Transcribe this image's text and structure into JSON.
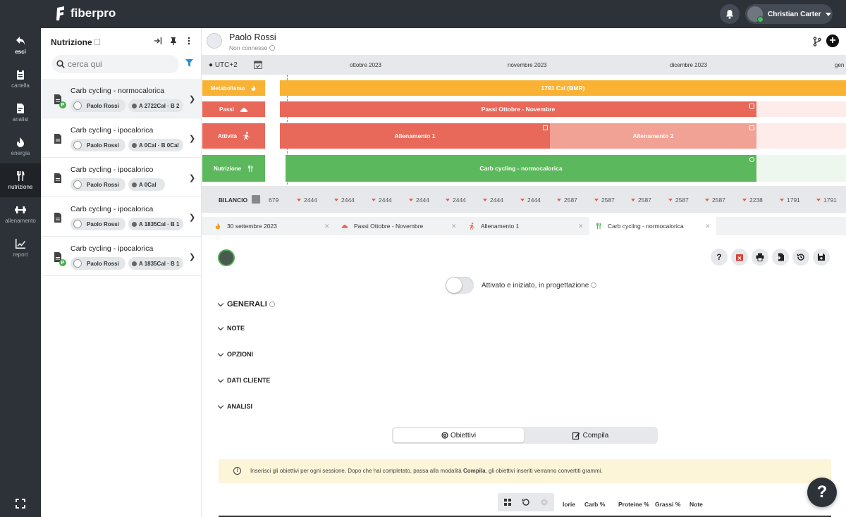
{
  "app": {
    "name": "fiberpro"
  },
  "topbar": {
    "user_name": "Christian Carter"
  },
  "leftnav": {
    "items": [
      {
        "label": "esci",
        "icon": "exit-icon"
      },
      {
        "label": "cartella",
        "icon": "clipboard-icon"
      },
      {
        "label": "analisi",
        "icon": "file-icon"
      },
      {
        "label": "energia",
        "icon": "flame-icon"
      },
      {
        "label": "nutrizione",
        "icon": "fork-knife-icon"
      },
      {
        "label": "allenamento",
        "icon": "dumbbell-icon"
      },
      {
        "label": "report",
        "icon": "chart-icon"
      }
    ]
  },
  "sidebar": {
    "title": "Nutrizione",
    "search_placeholder": "cerca qui",
    "cards": [
      {
        "title": "Carb cycling - normocalorica",
        "person": "Paolo Rossi",
        "cal": "A 2722Cal · B 2",
        "badge": "P"
      },
      {
        "title": "Carb cycling - ipocalorica",
        "person": "Paolo Rossi",
        "cal": "A 0Cal · B 0Cal",
        "badge": ""
      },
      {
        "title": "Carb cycling - ipocalorico",
        "person": "Paolo Rossi",
        "cal": "A 0Cal",
        "badge": ""
      },
      {
        "title": "Carb cycling - ipocalorica",
        "person": "Paolo Rossi",
        "cal": "A 1835Cal · B 1",
        "badge": ""
      },
      {
        "title": "Carb cycling - ipocalorica",
        "person": "Paolo Rossi",
        "cal": "A 1835Cal · B 1",
        "badge": "P"
      }
    ]
  },
  "patient": {
    "name": "Paolo Rossi",
    "status": "Non connesso"
  },
  "timeline": {
    "utc": "UTC+2",
    "months": [
      "ottobre 2023",
      "novembre 2023",
      "dicembre 2023",
      "gen"
    ],
    "rows": {
      "metabolismo": {
        "label": "Metabolismo",
        "bar": "1791 Cal (BMR)"
      },
      "passi": {
        "label": "Passi",
        "bar": "Passi Ottobre - Novembre"
      },
      "attivita": {
        "label": "Attività",
        "bar1": "Allenamento 1",
        "bar2": "Allenamento 2"
      },
      "nutrizione": {
        "label": "Nutrizione",
        "bar": "Carb cycling - normocalorica"
      }
    }
  },
  "bilancio": {
    "label": "BILANCIO",
    "first": "679",
    "values": [
      "2444",
      "2444",
      "2444",
      "2444",
      "2444",
      "2444",
      "2444",
      "2587",
      "2587",
      "2587",
      "2587",
      "2587",
      "2238",
      "1791",
      "1791"
    ]
  },
  "tabs": [
    {
      "label": "30 settembre 2023"
    },
    {
      "label": "Passi Ottobre - Novembre"
    },
    {
      "label": "Allenamento 1"
    },
    {
      "label": "Carb cycling - normocalorica"
    }
  ],
  "content": {
    "toggle_label": "Attivato e iniziato, in progettazione",
    "sections": [
      "GENERALI",
      "NOTE",
      "OPZIONI",
      "DATI CLIENTE",
      "ANALISI"
    ],
    "seg_obiettivi": "Obiettivi",
    "seg_compila": "Compila",
    "notice_pre": "Inserisci gli obiettivi per ogni sessione. Dopo che hai completato, passa alla modalità ",
    "notice_bold": "Compila",
    "notice_post": ", gli obiettivi inseriti verranno convertiti grammi.",
    "columns": [
      "lorie",
      "Carb %",
      "Proteine %",
      "Grassi %",
      "Note"
    ]
  },
  "help_label": "?",
  "colors": {
    "dark": "#2d3239",
    "metabolismo": "#f9b233",
    "passi": "#e8685a",
    "attivita": "#e8685a",
    "allenamento2": "#f2a195",
    "nutrizione": "#5cb85c"
  }
}
